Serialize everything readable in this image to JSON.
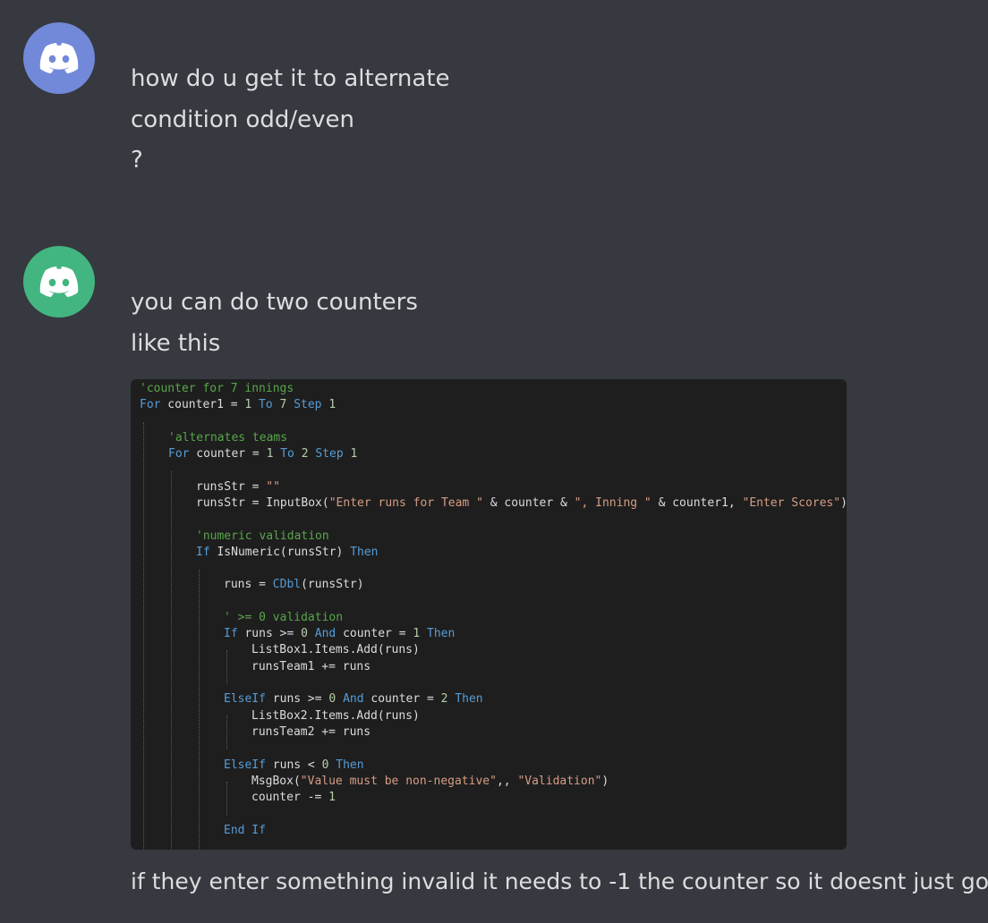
{
  "messages": [
    {
      "avatar_icon": "discord-logo-icon",
      "avatar_color": "#7289da",
      "lines": [
        "how do u get it to alternate",
        "condition odd/even",
        "?"
      ]
    },
    {
      "avatar_icon": "discord-logo-icon",
      "avatar_color": "#43b581",
      "lines": [
        "you can do two counters",
        "like this"
      ],
      "after_code": "if they enter something invalid it needs to -1 the counter so it doesnt just go"
    }
  ],
  "code": {
    "lines": [
      "'counter for 7 innings",
      "For counter1 = 1 To 7 Step 1",
      "",
      "'alternates teams",
      "For counter = 1 To 2 Step 1",
      "",
      "runsStr = \"\"",
      "runsStr = InputBox(\"Enter runs for Team \" & counter & \", Inning \" & counter1, \"Enter Scores\")",
      "",
      "'numeric validation",
      "If IsNumeric(runsStr) Then",
      "",
      "runs = CDbl(runsStr)",
      "",
      "' >= 0 validation",
      "If runs >= 0 And counter = 1 Then",
      "ListBox1.Items.Add(runs)",
      "runsTeam1 += runs",
      "",
      "ElseIf runs >= 0 And counter = 2 Then",
      "ListBox2.Items.Add(runs)",
      "runsTeam2 += runs",
      "",
      "ElseIf runs < 0 Then",
      "MsgBox(\"Value must be non-negative\",, \"Validation\")",
      "counter -= 1",
      "",
      "End If"
    ]
  },
  "colors": {
    "background": "#36393f",
    "code_background": "#1e1e1e",
    "comment": "#57a64a",
    "keyword": "#569cd6",
    "number": "#b5cea8",
    "string": "#d69d85"
  }
}
